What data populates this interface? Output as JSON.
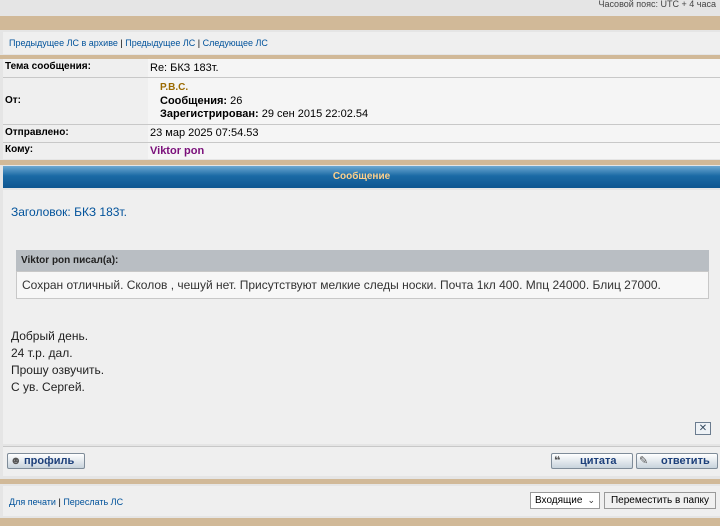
{
  "header": {
    "timezone": "Часовой пояс: UTC + 4 часа"
  },
  "nav": {
    "prev_archive": "Предыдущее ЛС в архиве",
    "prev": "Предыдущее ЛС",
    "next": "Следующее ЛС",
    "sep": "|"
  },
  "meta": {
    "subject_label": "Тема сообщения:",
    "subject_value": "Re: БКЗ 183т.",
    "from_label": "От:",
    "from_name": "P.B.C.",
    "posts_label": "Сообщения:",
    "posts_value": "26",
    "registered_label": "Зарегистрирован:",
    "registered_value": "29 сен 2015 22:02.54",
    "sent_label": "Отправлено:",
    "sent_value": "23 мар 2025 07:54.53",
    "to_label": "Кому:",
    "to_value": "Viktor pon"
  },
  "message": {
    "bar_title": "Сообщение",
    "heading": "Заголовок: БКЗ 183т.",
    "quote_author": "Viktor pon писал(а):",
    "quote_text": "Сохран отличный. Сколов , чешуй нет. Присутствуют мелкие следы носки. Почта 1кл 400. Мпц 24000. Блиц 27000.",
    "lines": [
      "Добрый день.",
      "24 т.р. дал.",
      "Прошу озвучить.",
      "С ув. Сергей."
    ]
  },
  "buttons": {
    "profile": "профиль",
    "quote": "цитата",
    "reply": "ответить"
  },
  "footer": {
    "print": "Для печати",
    "forward": "Переслать ЛС",
    "sep": "|",
    "folder_selected": "Входящие",
    "move_button": "Переместить в папку"
  },
  "colors": {
    "tan_bar": "#d1b998",
    "link": "#00529b",
    "from_name": "#9b6a00",
    "to_name": "#7a0f7a",
    "bar_title": "#ffd08a"
  }
}
